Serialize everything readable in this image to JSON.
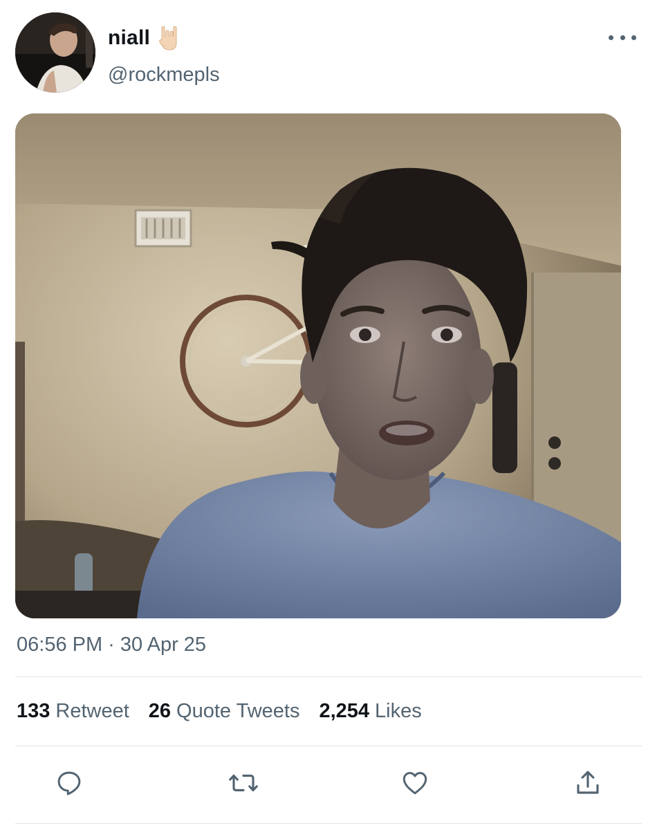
{
  "tweet": {
    "author": {
      "display_name": "niall",
      "name_emoji": "🤘",
      "handle": "@rockmepls"
    },
    "timestamp": "06:56 PM · 30 Apr 25",
    "stats": {
      "retweets_count": "133",
      "retweets_label": "Retweet",
      "quotes_count": "26",
      "quotes_label": "Quote Tweets",
      "likes_count": "2,254",
      "likes_label": "Likes"
    },
    "actions": [
      "reply-icon",
      "retweet-icon",
      "like-icon",
      "share-icon"
    ]
  },
  "colors": {
    "text_primary": "#0f1419",
    "text_secondary": "#536471",
    "divider": "#dfe3e6"
  }
}
